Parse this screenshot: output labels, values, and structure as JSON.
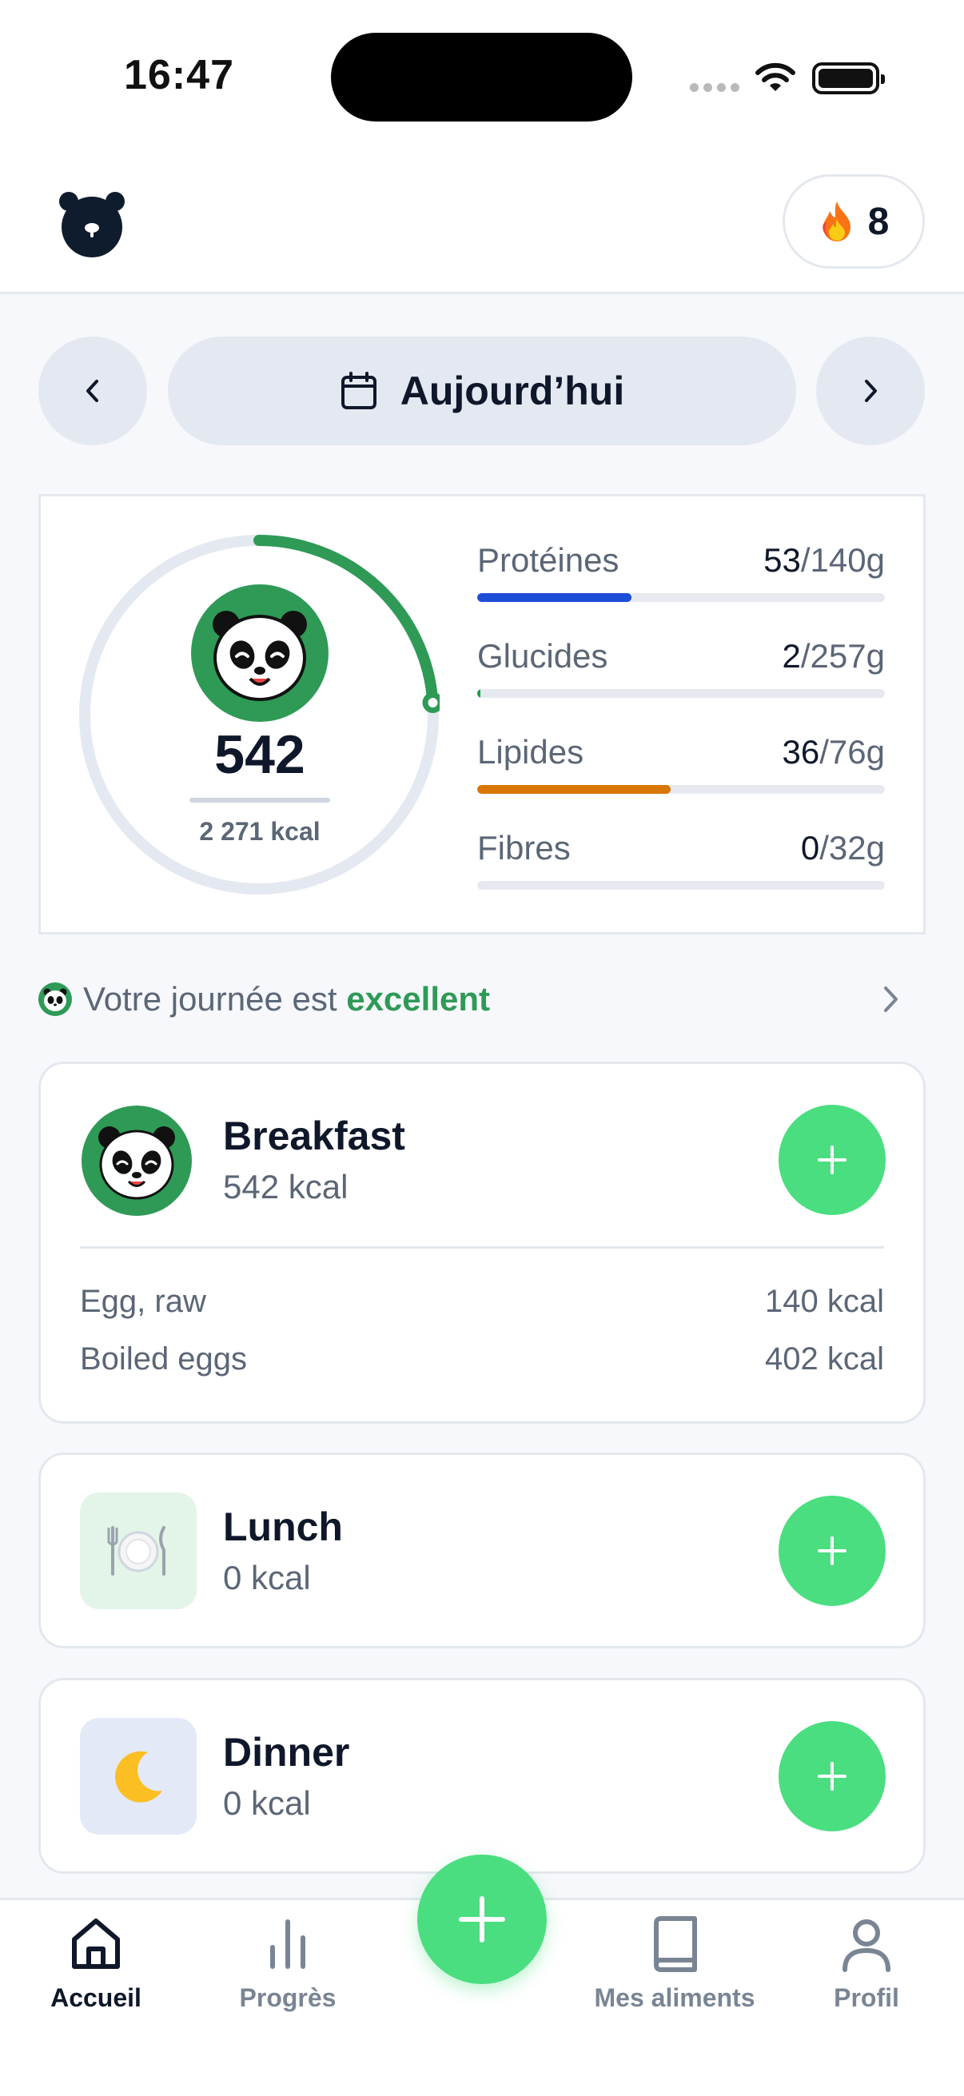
{
  "status_bar": {
    "time": "16:47"
  },
  "header": {
    "streak_count": "8"
  },
  "date_nav": {
    "label": "Aujourd’hui"
  },
  "summary": {
    "calories_eaten": "542",
    "calories_goal": "2 271 kcal",
    "progress_fraction": 0.239,
    "macros": [
      {
        "name": "Protéines",
        "current": "53",
        "goal": "/140g",
        "fraction": 0.379,
        "color": "#1d4ed8"
      },
      {
        "name": "Glucides",
        "current": "2",
        "goal": "/257g",
        "fraction": 0.008,
        "color": "#16a34a"
      },
      {
        "name": "Lipides",
        "current": "36",
        "goal": "/76g",
        "fraction": 0.474,
        "color": "#d97706"
      },
      {
        "name": "Fibres",
        "current": "0",
        "goal": "/32g",
        "fraction": 0.0,
        "color": "#9ca3af"
      }
    ]
  },
  "day_status": {
    "prefix": "Votre journée est ",
    "rating": "excellent"
  },
  "meals": [
    {
      "title": "Breakfast",
      "kcal": "542 kcal",
      "items": [
        {
          "name": "Egg, raw",
          "kcal": "140 kcal"
        },
        {
          "name": "Boiled eggs",
          "kcal": "402 kcal"
        }
      ]
    },
    {
      "title": "Lunch",
      "kcal": "0 kcal",
      "items": []
    },
    {
      "title": "Dinner",
      "kcal": "0 kcal",
      "items": []
    }
  ],
  "bottom_nav": {
    "tabs": [
      {
        "label": "Accueil",
        "icon": "home-icon",
        "active": true
      },
      {
        "label": "Progrès",
        "icon": "bar-chart-icon",
        "active": false
      },
      {
        "label": "Mes aliments",
        "icon": "book-icon",
        "active": false
      },
      {
        "label": "Profil",
        "icon": "person-icon",
        "active": false
      }
    ]
  },
  "colors": {
    "accent_green": "#4ade80",
    "brand_green": "#2e9a56",
    "text_dark": "#0f172a",
    "text_muted": "#5b6676"
  }
}
